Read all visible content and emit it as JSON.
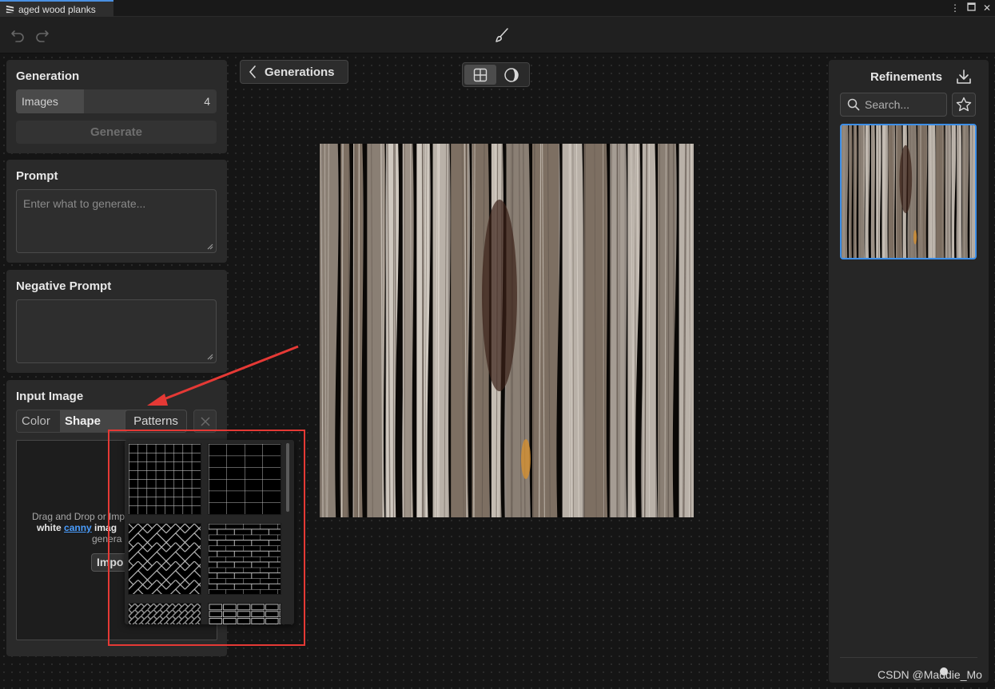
{
  "window": {
    "tab_title": "aged wood planks",
    "controls": [
      "more-vertical",
      "maximize",
      "close"
    ]
  },
  "toolbar": {
    "undo_icon": "undo-icon",
    "redo_icon": "redo-icon",
    "tool_icon": "brush-icon"
  },
  "generation_panel": {
    "title": "Generation",
    "images_label": "Images",
    "images_value": "4",
    "images_fill_fraction": 0.34,
    "generate_label": "Generate"
  },
  "prompt_panel": {
    "title": "Prompt",
    "placeholder": "Enter what to generate..."
  },
  "negative_prompt_panel": {
    "title": "Negative Prompt",
    "placeholder": ""
  },
  "input_image_panel": {
    "title": "Input Image",
    "tabs": [
      {
        "label": "Color",
        "active": false
      },
      {
        "label": "Shape",
        "active": true
      }
    ],
    "patterns_label": "Patterns",
    "drop_text_1": "Drag and Drop or Imp",
    "drop_text_bold": "white",
    "drop_link": "canny",
    "drop_text_2": "imag",
    "drop_text_3": "genera",
    "import_label": "Impo"
  },
  "patterns_popup": {
    "patterns": [
      "grid",
      "square-tiles",
      "herringbone",
      "bricks",
      "diagonal-weave",
      "stone-bricks"
    ]
  },
  "center": {
    "back_label": "Generations",
    "view_modes": [
      {
        "icon": "grid-view-icon",
        "active": true
      },
      {
        "icon": "material-sphere-icon",
        "active": false
      }
    ]
  },
  "refinements_panel": {
    "title": "Refinements",
    "search_placeholder": "Search...",
    "thumbnails": [
      "aged wood planks"
    ]
  },
  "watermark": "CSDN @Maddie_Mo",
  "colors": {
    "accent": "#3d8fe8",
    "annotation": "#e53935",
    "panel_bg": "#2a2a2a",
    "canvas_bg": "#151515"
  }
}
